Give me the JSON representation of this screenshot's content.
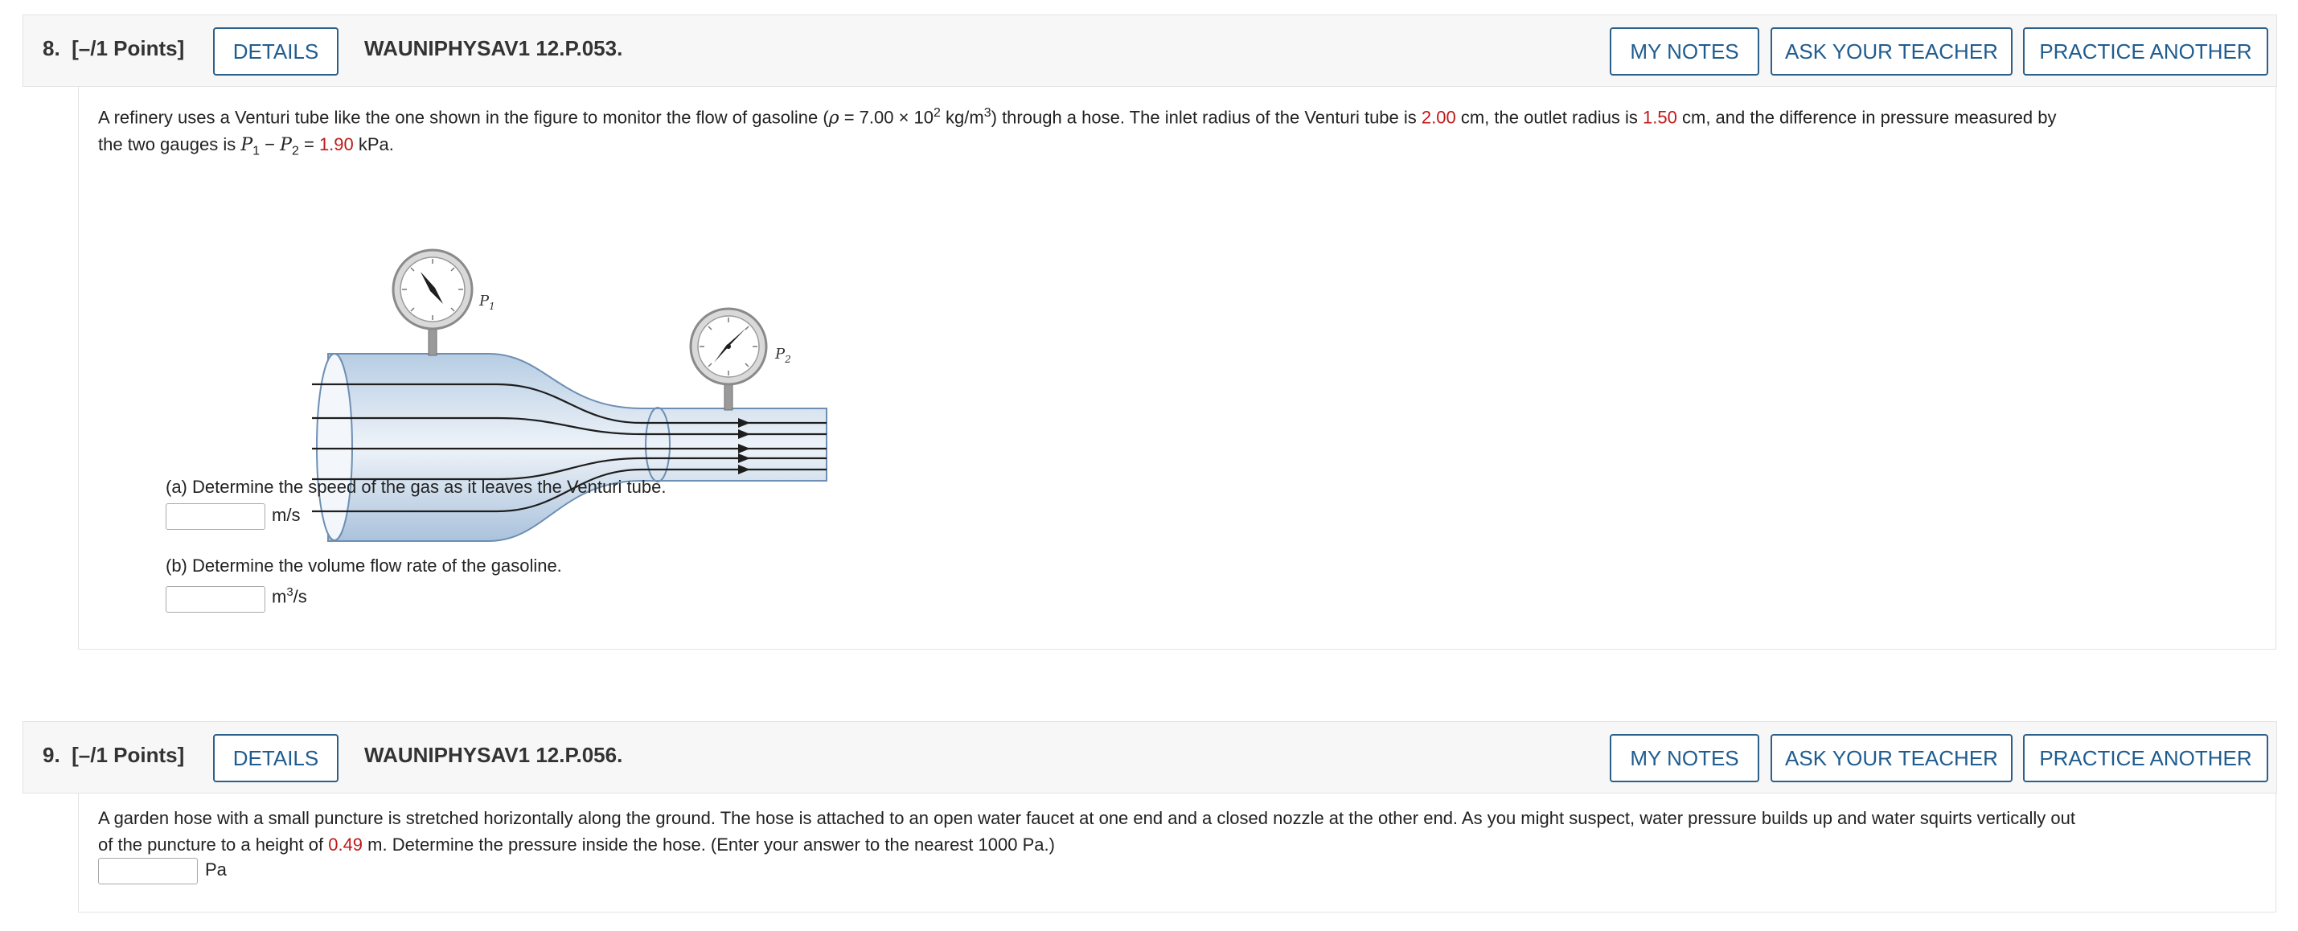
{
  "q8": {
    "number": "8.",
    "points": "[–/1 Points]",
    "details_label": "DETAILS",
    "code": "WAUNIPHYSAV1 12.P.053.",
    "my_notes_label": "MY NOTES",
    "ask_teacher_label": "ASK YOUR TEACHER",
    "practice_label": "PRACTICE ANOTHER",
    "text_1": "A refinery uses a Venturi tube like the one shown in the figure to monitor the flow of gasoline (",
    "rho": "ρ",
    "text_2": " = 7.00 × 10",
    "exp_1": "2",
    "text_3": " kg/m",
    "exp_2": "3",
    "text_4": ") through a hose. The inlet radius of the Venturi tube is ",
    "inlet_radius": "2.00",
    "text_5": " cm, the outlet radius is ",
    "outlet_radius": "1.50",
    "text_6": " cm, and the difference in pressure measured by",
    "text_7": "the two gauges is ",
    "p1": "P",
    "p1_sub": "1",
    "minus": " − ",
    "p2": "P",
    "p2_sub": "2",
    "text_8": " = ",
    "pressure_diff": "1.90",
    "text_9": " kPa.",
    "figure": {
      "p1_label": "P",
      "p1_sub": "1",
      "p2_label": "P",
      "p2_sub": "2"
    },
    "part_a": "(a) Determine the speed of the gas as it leaves the Venturi tube.",
    "unit_a": "m/s",
    "part_b": "(b) Determine the volume flow rate of the gasoline.",
    "unit_b": "m",
    "unit_b_exp": "3",
    "unit_b_tail": "/s"
  },
  "q9": {
    "number": "9.",
    "points": "[–/1 Points]",
    "details_label": "DETAILS",
    "code": "WAUNIPHYSAV1 12.P.056.",
    "my_notes_label": "MY NOTES",
    "ask_teacher_label": "ASK YOUR TEACHER",
    "practice_label": "PRACTICE ANOTHER",
    "text_1": "A garden hose with a small puncture is stretched horizontally along the ground. The hose is attached to an open water faucet at one end and a closed nozzle at the other end. As you might suspect, water pressure builds up and water squirts vertically out",
    "text_2": "of the puncture to a height of ",
    "height": "0.49",
    "text_3": " m. Determine the pressure inside the hose. (Enter your answer to the nearest 1000 Pa.)",
    "unit": "Pa"
  },
  "colors": {
    "accent": "#1f5c8f",
    "given_value": "#c0191a",
    "tube": "#c9d9ea"
  }
}
